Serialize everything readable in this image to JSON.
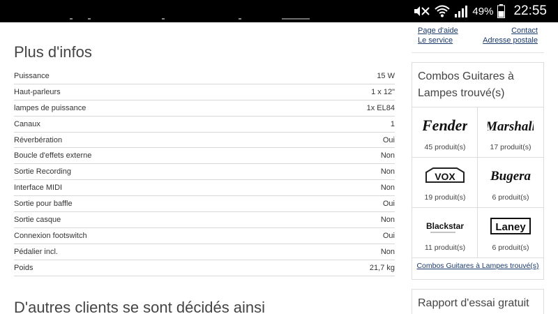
{
  "status_bar": {
    "battery_percent": "49%",
    "time": "22:55",
    "icons": [
      "mute-icon",
      "wifi-icon",
      "signal-icon",
      "battery-icon"
    ]
  },
  "help": {
    "page_aide": "Page d'aide",
    "contact": "Contact",
    "le_service": "Le service",
    "adresse_postale": "Adresse postale"
  },
  "specs": {
    "title": "Plus d'infos",
    "rows": [
      {
        "label": "Puissance",
        "value": "15 W"
      },
      {
        "label": "Haut-parleurs",
        "value": "1 x 12\""
      },
      {
        "label": "lampes de puissance",
        "value": "1x EL84"
      },
      {
        "label": "Canaux",
        "value": "1"
      },
      {
        "label": "Réverbération",
        "value": "Oui"
      },
      {
        "label": "Boucle d'effets externe",
        "value": "Non"
      },
      {
        "label": "Sortie Recording",
        "value": "Non"
      },
      {
        "label": "Interface MIDI",
        "value": "Non"
      },
      {
        "label": "Sortie pour baffle",
        "value": "Oui"
      },
      {
        "label": "Sortie casque",
        "value": "Non"
      },
      {
        "label": "Connexion footswitch",
        "value": "Oui"
      },
      {
        "label": "Pédalier incl.",
        "value": "Non"
      },
      {
        "label": "Poids",
        "value": "21,7 kg"
      }
    ]
  },
  "others": {
    "title": "D'autres clients se sont décidés ainsi"
  },
  "brands": {
    "title": "Combos Guitares à Lampes trouvé(s)",
    "items": [
      {
        "name": "Fender",
        "count": "45 produit(s)"
      },
      {
        "name": "Marshall",
        "count": "17 produit(s)"
      },
      {
        "name": "VOX",
        "count": "19 produit(s)"
      },
      {
        "name": "Bugera",
        "count": "6 produit(s)"
      },
      {
        "name": "Blackstar",
        "count": "11 produit(s)"
      },
      {
        "name": "Laney",
        "count": "6 produit(s)"
      }
    ],
    "footer_link": "Combos Guitares à Lampes trouvé(s)"
  },
  "report": {
    "title": "Rapport d'essai gratuit"
  },
  "colors": {
    "link": "#1a3a6b",
    "border": "#dcdcdc",
    "status_bar": "#000000"
  }
}
